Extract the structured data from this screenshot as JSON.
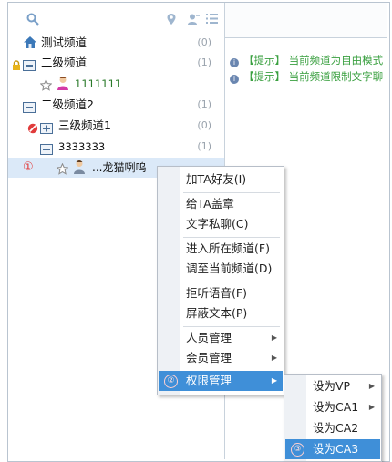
{
  "tips": [
    {
      "tag": "【提示】",
      "text": "当前频道为自由模式"
    },
    {
      "tag": "【提示】",
      "text": "当前频道限制文字聊"
    }
  ],
  "tree": [
    {
      "label": "测试频道",
      "count": "(0)"
    },
    {
      "label": "二级频道",
      "count": "(1)"
    },
    {
      "user": "1111111"
    },
    {
      "label": "二级频道2",
      "count": "(1)"
    },
    {
      "label": "三级频道1",
      "count": "(0)"
    },
    {
      "label": "3333333",
      "count": "(1)"
    },
    {
      "user": "...龙猫咧呜",
      "marker": "①"
    }
  ],
  "context_menu": {
    "items": [
      {
        "label": "加TA好友(I)"
      },
      {
        "label": "给TA盖章"
      },
      {
        "label": "文字私聊(C)"
      },
      {
        "label": "进入所在频道(F)"
      },
      {
        "label": "调至当前频道(D)"
      },
      {
        "label": "拒听语音(F)"
      },
      {
        "label": "屏蔽文本(P)"
      },
      {
        "label": "人员管理"
      },
      {
        "label": "会员管理"
      },
      {
        "label": "权限管理",
        "marker": "②"
      }
    ]
  },
  "submenu": {
    "items": [
      {
        "label": "设为VP"
      },
      {
        "label": "设为CA1"
      },
      {
        "label": "设为CA2"
      },
      {
        "label": "设为CA3",
        "marker": "③"
      }
    ]
  }
}
